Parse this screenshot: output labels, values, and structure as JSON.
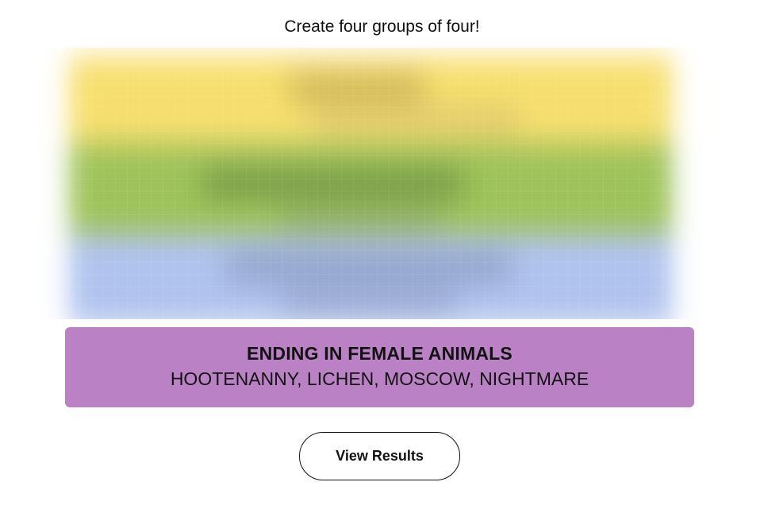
{
  "instruction": "Create four groups of four!",
  "blurred_groups": [
    {
      "color": "#f7df6f"
    },
    {
      "color": "#9fc35a"
    },
    {
      "color": "#b0c3ee"
    }
  ],
  "revealed_group": {
    "title": "ENDING IN FEMALE ANIMALS",
    "members": "HOOTENANNY, LICHEN, MOSCOW, NIGHTMARE",
    "color": "#ba81c5"
  },
  "view_results_label": "View Results"
}
